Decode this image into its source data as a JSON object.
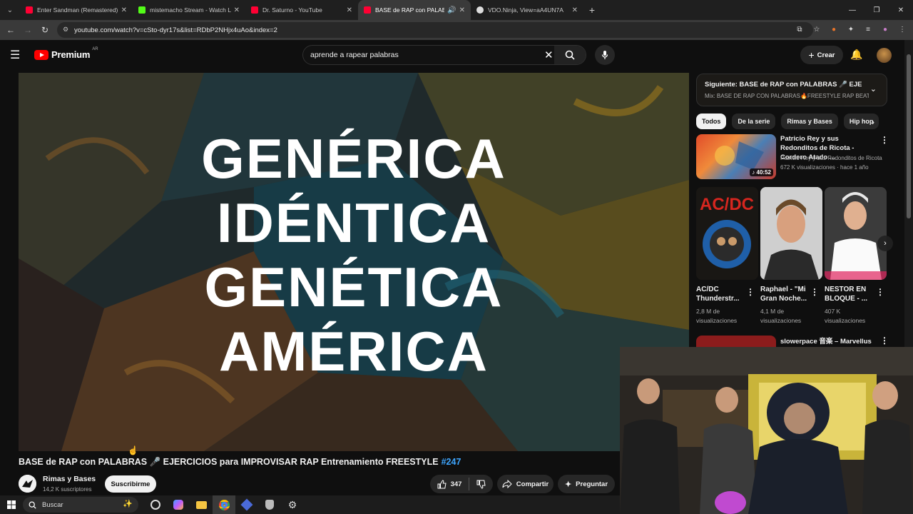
{
  "browser": {
    "tabs": [
      {
        "title": "Enter Sandman (Remastered) -",
        "fav_color": "#ff0033"
      },
      {
        "title": "mistemacho Stream - Watch Li",
        "fav_color": "#53fc18"
      },
      {
        "title": "Dr. Saturno - YouTube",
        "fav_color": "#ff0033"
      },
      {
        "title": "BASE de RAP con PALABRA",
        "fav_color": "#ff0033",
        "active": true
      },
      {
        "title": "VDO.Ninja, View=aA4UN7A",
        "fav_color": "#dddddd"
      }
    ],
    "url": "youtube.com/watch?v=cSto-dyr17s&list=RDbP2NHjx4uAo&index=2"
  },
  "header": {
    "logo_text": "Premium",
    "logo_region": "AR",
    "search_query": "aprende a rapear palabras",
    "create_label": "Crear"
  },
  "video": {
    "lyrics": [
      "GENÉRICA",
      "IDÉNTICA",
      "GENÉTICA",
      "AMÉRICA"
    ],
    "title": "BASE de RAP con PALABRAS 🎤 EJERCICIOS para IMPROVISAR RAP Entrenamiento FREESTYLE",
    "hashtag": "#247",
    "channel": "Rimas y Bases",
    "subscribers": "14,2 K suscriptores",
    "subscribe_label": "Suscribirme",
    "likes": "347",
    "share_label": "Compartir",
    "ask_label": "Preguntar"
  },
  "sidebar": {
    "next_title": "Siguiente: BASE de RAP con PALABRAS 🎤 EJERCI...",
    "next_sub": "Mix: BASE DE RAP CON PALABRAS🔥FREESTYLE RAP BEAT...",
    "chips": [
      "Todos",
      "De la serie",
      "Rimas y Bases",
      "Hip hop"
    ],
    "rec1": {
      "title": "Patricio Rey y sus Redonditos de Ricota - Cordero Atado ...",
      "channel": "Patricio Rey y sus Redonditos de Ricota",
      "meta": "672 K visualizaciones · hace 1 año",
      "duration": "40:52"
    },
    "shorts": [
      {
        "title": "AC/DC Thunderstr...",
        "views": "2,8 M de visualizaciones"
      },
      {
        "title": "Raphael - \"Mi Gran Noche...",
        "views": "4,1 M de visualizaciones"
      },
      {
        "title": "NESTOR EN BLOQUE - ...",
        "views": "407 K visualizaciones"
      }
    ],
    "rec2_title": "slowerpace 音楽 – Marvellus"
  },
  "taskbar": {
    "search_label": "Buscar"
  }
}
